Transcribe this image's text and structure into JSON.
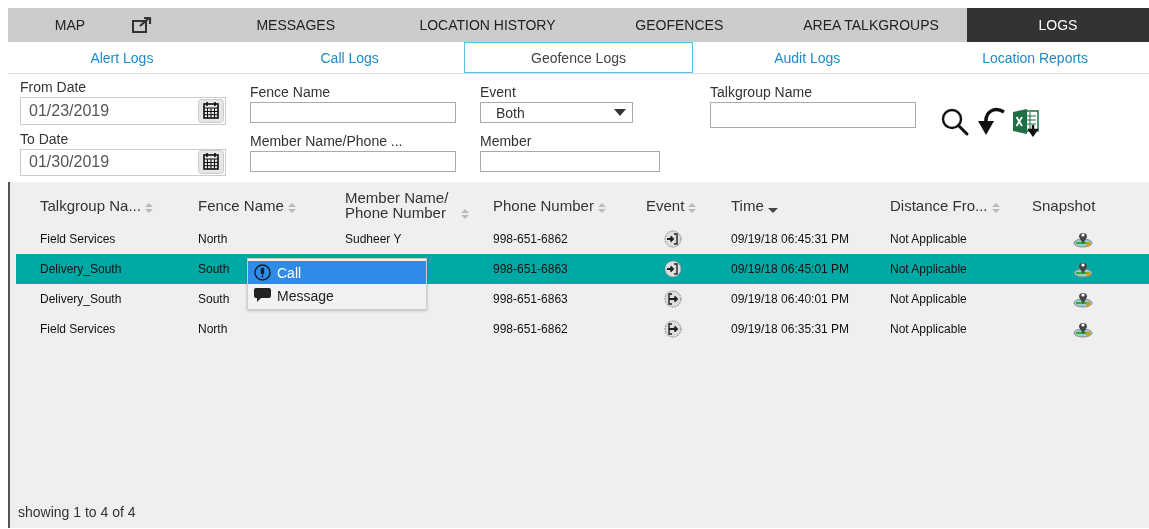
{
  "main_tabs": [
    {
      "label": "MAP",
      "selected": false,
      "popout": true
    },
    {
      "label": "MESSAGES",
      "selected": false,
      "popout": false
    },
    {
      "label": "LOCATION HISTORY",
      "selected": false,
      "popout": false
    },
    {
      "label": "GEOFENCES",
      "selected": false,
      "popout": false
    },
    {
      "label": "AREA TALKGROUPS",
      "selected": false,
      "popout": false
    },
    {
      "label": "LOGS",
      "selected": true,
      "popout": false
    }
  ],
  "sub_tabs": [
    {
      "label": "Alert Logs",
      "selected": false
    },
    {
      "label": "Call Logs",
      "selected": false
    },
    {
      "label": "Geofence Logs",
      "selected": true
    },
    {
      "label": "Audit Logs",
      "selected": false
    },
    {
      "label": "Location Reports",
      "selected": false
    }
  ],
  "filters": {
    "from_date": {
      "label": "From Date",
      "value": "01/23/2019"
    },
    "to_date": {
      "label": "To Date",
      "value": "01/30/2019"
    },
    "fence_name": {
      "label": "Fence Name"
    },
    "member_name": {
      "label": "Member Name/Phone ..."
    },
    "event": {
      "label": "Event",
      "value": "Both"
    },
    "member": {
      "label": "Member"
    },
    "talkgroup_name": {
      "label": "Talkgroup Name"
    }
  },
  "table": {
    "columns": [
      {
        "label": "Talkgroup Na...",
        "sortable": true,
        "sorted_descending": false
      },
      {
        "label": "Fence Name",
        "sortable": true,
        "sorted_descending": false
      },
      {
        "label": "Member Name/ Phone Number",
        "sortable": true,
        "sorted_descending": false
      },
      {
        "label": "Phone Number",
        "sortable": true,
        "sorted_descending": false
      },
      {
        "label": "Event",
        "sortable": true,
        "sorted_descending": false
      },
      {
        "label": "Time",
        "sortable": true,
        "sorted_descending": true
      },
      {
        "label": "Distance Fro...",
        "sortable": true,
        "sorted_descending": false
      },
      {
        "label": "Snapshot"
      }
    ],
    "rows": [
      {
        "talkgroup": "Field Services",
        "fence": "North",
        "member": "Sudheer Y",
        "phone": "998-651-6862",
        "event": {
          "kind": "enter"
        },
        "time": "09/19/18 06:45:31 PM",
        "distance": "Not Applicable",
        "selected": false
      },
      {
        "talkgroup": "Delivery_South",
        "fence": "South",
        "phone": "998-651-6863",
        "event": {
          "kind": "enter"
        },
        "time": "09/19/18 06:45:01 PM",
        "distance": "Not Applicable",
        "selected": true
      },
      {
        "talkgroup": "Delivery_South",
        "fence": "South",
        "phone": "998-651-6863",
        "event": {
          "kind": "exit"
        },
        "time": "09/19/18 06:40:01 PM",
        "distance": "Not Applicable",
        "selected": false
      },
      {
        "talkgroup": "Field Services",
        "fence": "North",
        "phone": "998-651-6862",
        "event": {
          "kind": "exit"
        },
        "time": "09/19/18 06:35:31 PM",
        "distance": "Not Applicable",
        "selected": false
      }
    ],
    "footer": "showing 1 to 4 of 4"
  },
  "context_menu": [
    {
      "label": "Call",
      "kind": "call",
      "selected": true
    },
    {
      "label": "Message",
      "kind": "message",
      "selected": false
    }
  ]
}
